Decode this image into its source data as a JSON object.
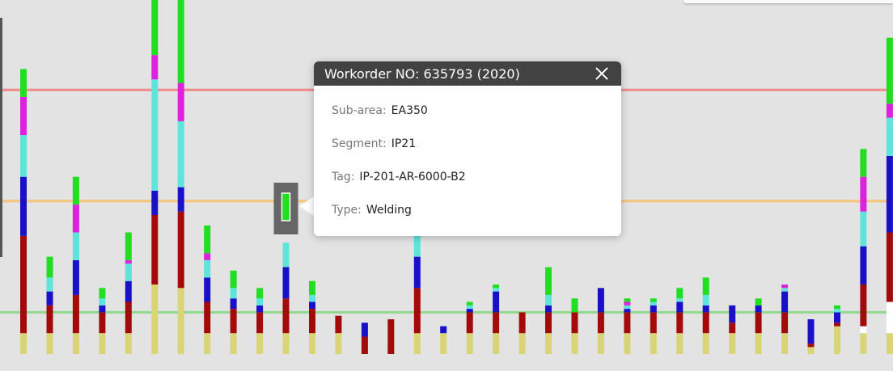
{
  "chart_data": {
    "type": "bar",
    "stacked": true,
    "grid": false,
    "legend": "none",
    "ylim": [
      0,
      100
    ],
    "segment_order": [
      "khaki",
      "white",
      "darkred",
      "blue",
      "cyan",
      "magenta",
      "green"
    ],
    "segment_colors": {
      "khaki": "#d9d577",
      "white": "#ffffff",
      "darkred": "#a30a0a",
      "blue": "#1a10c8",
      "cyan": "#5fe4dc",
      "magenta": "#dd22dd",
      "green": "#22dd22"
    },
    "reference_lines": [
      {
        "value": 76,
        "color": "#f08a8a"
      },
      {
        "value": 44,
        "color": "#f5c37a"
      },
      {
        "value": 12,
        "color": "#8fd98f"
      }
    ],
    "series": [
      {
        "name": "khaki",
        "values": [
          6,
          6,
          6,
          6,
          6,
          20,
          19,
          6,
          6,
          6,
          6,
          6,
          6,
          0,
          0,
          6,
          6,
          6,
          6,
          6,
          6,
          6,
          6,
          6,
          6,
          6,
          6,
          6,
          6,
          6,
          2,
          8,
          6,
          6,
          6
        ]
      },
      {
        "name": "white",
        "values": [
          0,
          0,
          0,
          0,
          0,
          0,
          0,
          0,
          0,
          0,
          0,
          0,
          0,
          0,
          0,
          0,
          0,
          0,
          0,
          0,
          0,
          0,
          0,
          0,
          0,
          0,
          0,
          0,
          0,
          0,
          0,
          0,
          2,
          9,
          5
        ]
      },
      {
        "name": "darkred",
        "values": [
          28,
          8,
          11,
          6,
          9,
          20,
          22,
          9,
          7,
          6,
          10,
          7,
          5,
          5,
          10,
          13,
          0,
          6,
          6,
          6,
          6,
          6,
          6,
          6,
          6,
          6,
          6,
          3,
          6,
          6,
          1,
          1,
          12,
          20,
          5
        ]
      },
      {
        "name": "blue",
        "values": [
          17,
          4,
          10,
          2,
          6,
          7,
          7,
          7,
          3,
          2,
          9,
          2,
          0,
          4,
          0,
          9,
          2,
          1,
          6,
          0,
          2,
          0,
          7,
          1,
          2,
          3,
          2,
          5,
          2,
          6,
          7,
          3,
          11,
          22,
          7
        ]
      },
      {
        "name": "cyan",
        "values": [
          12,
          4,
          8,
          2,
          5,
          32,
          19,
          5,
          3,
          2,
          7,
          2,
          0,
          0,
          0,
          7,
          0,
          1,
          1,
          0,
          3,
          0,
          0,
          1,
          1,
          1,
          3,
          0,
          0,
          1,
          0,
          1,
          10,
          11,
          5
        ]
      },
      {
        "name": "magenta",
        "values": [
          11,
          0,
          8,
          0,
          1,
          7,
          11,
          2,
          0,
          0,
          0,
          0,
          0,
          0,
          0,
          4,
          0,
          0,
          0,
          0,
          0,
          0,
          0,
          1,
          0,
          0,
          0,
          0,
          0,
          1,
          0,
          0,
          10,
          4,
          5
        ]
      },
      {
        "name": "green",
        "values": [
          8,
          6,
          8,
          3,
          8,
          20,
          24,
          8,
          5,
          3,
          0,
          4,
          0,
          0,
          0,
          0,
          0,
          1,
          1,
          0,
          8,
          4,
          0,
          1,
          1,
          3,
          5,
          0,
          2,
          0,
          0,
          1,
          8,
          19,
          4
        ]
      }
    ]
  },
  "tooltip": {
    "title": "Workorder NO: 635793 (2020)",
    "rows": [
      {
        "label": "Sub-area:",
        "value": "EA350"
      },
      {
        "label": "Segment:",
        "value": "IP21"
      },
      {
        "label": "Tag:",
        "value": "IP-201-AR-6000-B2"
      },
      {
        "label": "Type:",
        "value": "Welding"
      }
    ],
    "selected_bar_index": 10,
    "selected_color": "#22dd22",
    "highlight_color": "#666666"
  }
}
